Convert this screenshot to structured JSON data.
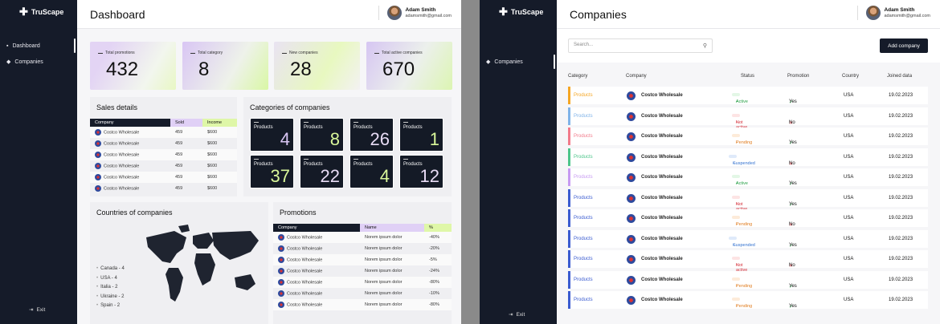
{
  "brand": "TruScape",
  "user": {
    "name": "Adam Smith",
    "email": "adamsmith@gmail.com"
  },
  "dashboard": {
    "title": "Dashboard",
    "nav": [
      "Dashboard",
      "Companies"
    ],
    "exit": "Exit",
    "stats": [
      {
        "label": "Total promotions",
        "value": "432"
      },
      {
        "label": "Total category",
        "value": "8"
      },
      {
        "label": "New companies",
        "value": "28"
      },
      {
        "label": "Total active companies",
        "value": "670"
      }
    ],
    "sales": {
      "title": "Sales details",
      "headers": [
        "Company",
        "Sold",
        "Income"
      ],
      "rows": [
        [
          "Costco Wholesale",
          "459",
          "$600"
        ],
        [
          "Costco Wholesale",
          "459",
          "$600"
        ],
        [
          "Costco Wholesale",
          "459",
          "$600"
        ],
        [
          "Costco Wholesale",
          "459",
          "$600"
        ],
        [
          "Costco Wholesale",
          "459",
          "$600"
        ],
        [
          "Costco Wholesale",
          "459",
          "$600"
        ]
      ]
    },
    "categories": {
      "title": "Categories of companies",
      "items": [
        {
          "label": "Products",
          "value": "4",
          "color": "#d9c6f4"
        },
        {
          "label": "Products",
          "value": "8",
          "color": "#d9f79a"
        },
        {
          "label": "Products",
          "value": "26",
          "color": "#e8dcf5"
        },
        {
          "label": "Products",
          "value": "1",
          "color": "#d9f79a"
        },
        {
          "label": "Products",
          "value": "37",
          "color": "#d9f79a"
        },
        {
          "label": "Products",
          "value": "22",
          "color": "#e8dcf5"
        },
        {
          "label": "Products",
          "value": "4",
          "color": "#d9f79a"
        },
        {
          "label": "Products",
          "value": "12",
          "color": "#e8dcf5"
        }
      ]
    },
    "countries": {
      "title": "Countries of companies",
      "items": [
        "Canada - 4",
        "USA - 4",
        "Italia - 2",
        "Ukraine - 2",
        "Spain - 2"
      ]
    },
    "promotions": {
      "title": "Promotions",
      "headers": [
        "Company",
        "Name",
        "%"
      ],
      "rows": [
        [
          "Costco Wholesale",
          "Norem ipsum dolor",
          "-40%"
        ],
        [
          "Costco Wholesale",
          "Norem ipsum dolor",
          "-20%"
        ],
        [
          "Costco Wholesale",
          "Norem ipsum dolor",
          "-5%"
        ],
        [
          "Costco Wholesale",
          "Norem ipsum dolor",
          "-24%"
        ],
        [
          "Costco Wholesale",
          "Norem ipsum dolor",
          "-80%"
        ],
        [
          "Costco Wholesale",
          "Norem ipsum dolor",
          "-10%"
        ],
        [
          "Costco Wholesale",
          "Norem ipsum dolor",
          "-80%"
        ]
      ]
    }
  },
  "companies": {
    "title": "Companies",
    "nav": [
      "Companies"
    ],
    "exit": "Exit",
    "search_placeholder": "Search...",
    "add_button": "Add company",
    "headers": [
      "Category",
      "Company",
      "Status",
      "Promotion",
      "Country",
      "Joined data"
    ],
    "rows": [
      {
        "category": "Products",
        "company": "Costco Wholesale",
        "status": "Active",
        "promotion": "Yes",
        "country": "USA",
        "joined": "19.02.2023",
        "bar": "#f5a623"
      },
      {
        "category": "Products",
        "company": "Costco Wholesale",
        "status": "Not active",
        "promotion": "No",
        "country": "USA",
        "joined": "19.02.2023",
        "bar": "#7fb3e8"
      },
      {
        "category": "Products",
        "company": "Costco Wholesale",
        "status": "Pending",
        "promotion": "Yes",
        "country": "USA",
        "joined": "19.02.2023",
        "bar": "#f27a8a"
      },
      {
        "category": "Products",
        "company": "Costco Wholesale",
        "status": "Suspended",
        "promotion": "No",
        "country": "USA",
        "joined": "19.02.2023",
        "bar": "#4cc58a"
      },
      {
        "category": "Products",
        "company": "Costco Wholesale",
        "status": "Active",
        "promotion": "Yes",
        "country": "USA",
        "joined": "19.02.2023",
        "bar": "#c79af2"
      },
      {
        "category": "Products",
        "company": "Costco Wholesale",
        "status": "Not active",
        "promotion": "Yes",
        "country": "USA",
        "joined": "19.02.2023",
        "bar": "#3a5bd0"
      },
      {
        "category": "Products",
        "company": "Costco Wholesale",
        "status": "Pending",
        "promotion": "No",
        "country": "USA",
        "joined": "19.02.2023",
        "bar": "#3a5bd0"
      },
      {
        "category": "Products",
        "company": "Costco Wholesale",
        "status": "Suspended",
        "promotion": "Yes",
        "country": "USA",
        "joined": "19.02.2023",
        "bar": "#3a5bd0"
      },
      {
        "category": "Products",
        "company": "Costco Wholesale",
        "status": "Not active",
        "promotion": "No",
        "country": "USA",
        "joined": "19.02.2023",
        "bar": "#3a5bd0"
      },
      {
        "category": "Products",
        "company": "Costco Wholesale",
        "status": "Pending",
        "promotion": "Yes",
        "country": "USA",
        "joined": "19.02.2023",
        "bar": "#3a5bd0"
      },
      {
        "category": "Products",
        "company": "Costco Wholesale",
        "status": "Pending",
        "promotion": "Yes",
        "country": "USA",
        "joined": "19.02.2023",
        "bar": "#3a5bd0"
      }
    ]
  },
  "status_colors": {
    "Active": {
      "bg": "#e3f7e6",
      "fg": "#27a047"
    },
    "Not active": {
      "bg": "#fde4e4",
      "fg": "#d6333d"
    },
    "Pending": {
      "bg": "#fdebd9",
      "fg": "#e07b1d"
    },
    "Suspended": {
      "bg": "#dfeafa",
      "fg": "#3473d0"
    }
  }
}
